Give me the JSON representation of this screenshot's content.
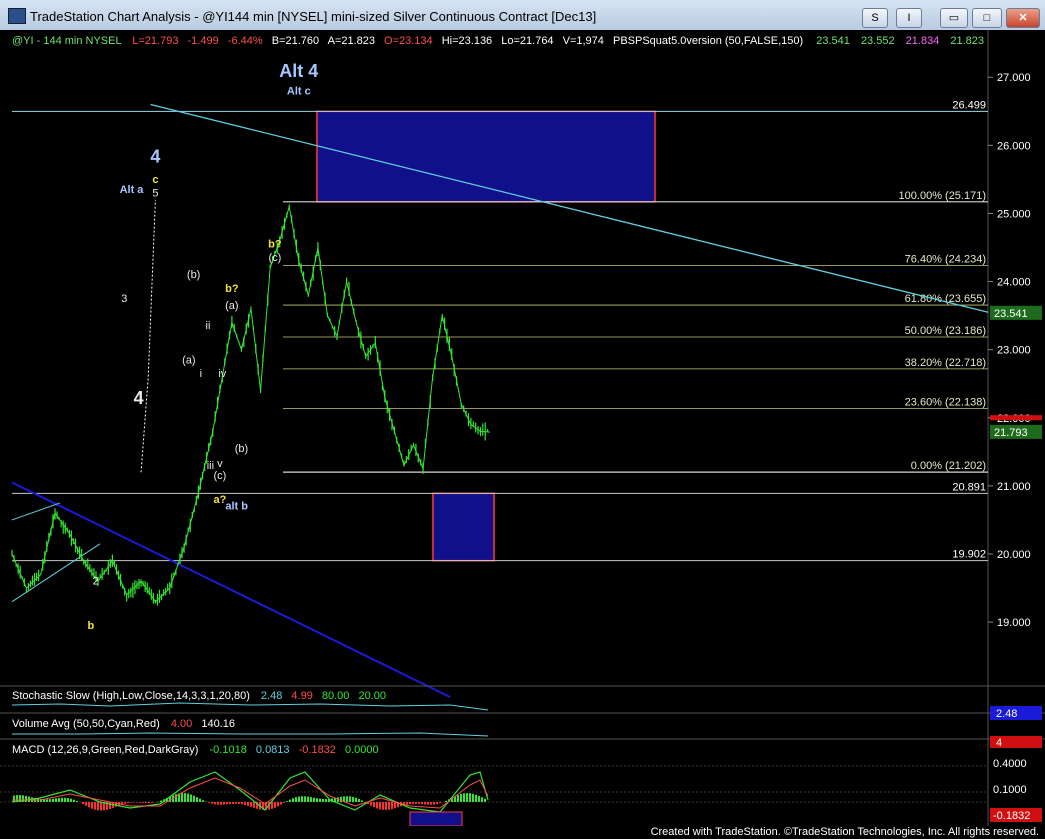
{
  "window": {
    "title": "TradeStation Chart Analysis - @YI144 min [NYSEL] mini-sized Silver Continuous Contract [Dec13]",
    "btn_s": "S",
    "btn_i": "I",
    "btn_min": "▭",
    "btn_max": "□",
    "btn_close": "✕"
  },
  "status": {
    "symbol": "@YI - 144 min  NYSEL",
    "last": "L=21.793",
    "change": "-1.499",
    "change_pct": "-6.44%",
    "bid": "B=21.760",
    "ask": "A=21.823",
    "open": "O=23.134",
    "high": "Hi=23.136",
    "low": "Lo=21.764",
    "volume": "V=1,974",
    "indicator": "PBSPSquat5.0version (50,FALSE,150)",
    "ind_v1": "23.541",
    "ind_v2": "23.552",
    "ind_v3": "21.834",
    "ind_v4": "21.823"
  },
  "colors": {
    "bars": "#33e633",
    "price_text": "#ffffff",
    "fib_line": "#c9c97a",
    "trend_cyan": "#5fd0e0",
    "trend_blue": "#1a1ad8",
    "box_fill": "#10108a",
    "box_border": "#ff3b3b",
    "label_blue": "#a8c6ff",
    "label_yellow": "#f0e040"
  },
  "chart_data": {
    "type": "line",
    "title": "@YI144 min [NYSEL] mini-sized Silver Continuous Contract [Dec13]",
    "ylim": [
      18.15,
      27.4
    ],
    "y_ticks": [
      "27.000",
      "26.000",
      "25.000",
      "24.000",
      "23.000",
      "22.000",
      "21.000",
      "20.000",
      "19.000"
    ],
    "y_tick_values": [
      27,
      26,
      25,
      24,
      23,
      22,
      21,
      20,
      19
    ],
    "x_range": [
      0,
      100
    ],
    "series": [
      {
        "name": "@YI",
        "x": [
          0,
          3,
          6,
          9,
          12,
          15,
          18,
          21,
          24,
          27,
          30,
          33,
          36,
          39,
          42,
          44,
          46,
          48,
          50,
          52,
          54,
          56,
          58,
          60,
          62,
          64,
          66,
          68,
          70,
          72,
          74,
          76,
          78,
          80,
          82,
          84,
          86,
          88,
          90,
          92,
          94,
          96,
          98,
          100
        ],
        "values": [
          20.0,
          19.5,
          19.7,
          20.6,
          20.3,
          19.9,
          19.6,
          19.9,
          19.4,
          19.6,
          19.3,
          19.5,
          20.1,
          20.9,
          21.8,
          22.6,
          23.4,
          23.0,
          23.6,
          22.4,
          24.2,
          24.6,
          25.1,
          24.3,
          23.8,
          24.5,
          23.5,
          23.2,
          24.0,
          23.4,
          22.9,
          23.1,
          22.3,
          21.8,
          21.3,
          21.6,
          21.25,
          22.6,
          23.5,
          22.9,
          22.2,
          21.9,
          21.8,
          21.79
        ]
      }
    ],
    "current_price": 21.793,
    "indicator_value": 23.541,
    "levels": [
      {
        "label": "100.00% (25.171)",
        "value": 25.171
      },
      {
        "label": "76.40% (24.234)",
        "value": 24.234
      },
      {
        "label": "61.80% (23.655)",
        "value": 23.655
      },
      {
        "label": "50.00% (23.186)",
        "value": 23.186
      },
      {
        "label": "38.20% (22.718)",
        "value": 22.718
      },
      {
        "label": "23.60% (22.138)",
        "value": 22.138
      },
      {
        "label": "0.00% (21.202)",
        "value": 21.202
      }
    ],
    "price_marks": [
      {
        "label": "26.499",
        "value": 26.499
      },
      {
        "label": "20.891",
        "value": 20.891
      },
      {
        "label": "19.902",
        "value": 19.902
      }
    ],
    "annotations": [
      {
        "text": "Alt 4",
        "color": "blue",
        "x": 60,
        "y": 27.0
      },
      {
        "text": "Alt c",
        "color": "blue",
        "x": 60,
        "y": 26.75
      },
      {
        "text": "4",
        "color": "blue",
        "x": 30,
        "y": 25.75
      },
      {
        "text": "c",
        "color": "yellow",
        "x": 30,
        "y": 25.45
      },
      {
        "text": "5",
        "color": "white",
        "x": 30,
        "y": 25.25
      },
      {
        "text": "Alt a",
        "color": "blue",
        "x": 25,
        "y": 25.3
      },
      {
        "text": "b?",
        "color": "yellow",
        "x": 55,
        "y": 24.5
      },
      {
        "text": "(c)",
        "color": "white",
        "x": 55,
        "y": 24.3
      },
      {
        "text": "b?",
        "color": "yellow",
        "x": 46,
        "y": 23.85
      },
      {
        "text": "(a)",
        "color": "white",
        "x": 46,
        "y": 23.6
      },
      {
        "text": "(b)",
        "color": "white",
        "x": 38,
        "y": 24.05
      },
      {
        "text": "3",
        "color": "white",
        "x": 23.5,
        "y": 23.7
      },
      {
        "text": "ii",
        "color": "white",
        "x": 41,
        "y": 23.3
      },
      {
        "text": "(a)",
        "color": "white",
        "x": 37,
        "y": 22.8
      },
      {
        "text": "i",
        "color": "white",
        "x": 39.5,
        "y": 22.6
      },
      {
        "text": "iv",
        "color": "white",
        "x": 44,
        "y": 22.6
      },
      {
        "text": "4",
        "color": "white",
        "x": 26.5,
        "y": 22.2
      },
      {
        "text": "(b)",
        "color": "white",
        "x": 48,
        "y": 21.5
      },
      {
        "text": "iii",
        "color": "white",
        "x": 41.5,
        "y": 21.25
      },
      {
        "text": "v",
        "color": "white",
        "x": 43.5,
        "y": 21.28
      },
      {
        "text": "(c)",
        "color": "white",
        "x": 43.5,
        "y": 21.1
      },
      {
        "text": "a?",
        "color": "yellow",
        "x": 43.5,
        "y": 20.75
      },
      {
        "text": "alt b",
        "color": "blue",
        "x": 47,
        "y": 20.65
      },
      {
        "text": "2",
        "color": "white",
        "x": 17.5,
        "y": 19.55
      },
      {
        "text": "b",
        "color": "yellow",
        "x": 16.5,
        "y": 18.9
      }
    ]
  },
  "indicators": {
    "stoch_label": "Stochastic Slow (High,Low,Close,14,3,3,1,20,80)",
    "stoch_v1": "2.48",
    "stoch_v2": "4.99",
    "stoch_v3": "80.00",
    "stoch_v4": "20.00",
    "stoch_axis": "2.48",
    "vol_label": "Volume Avg (50,50,Cyan,Red)",
    "vol_v1": "4.00",
    "vol_v2": "140.16",
    "vol_axis": "4",
    "macd_label": "MACD (12,26,9,Green,Red,DarkGray)",
    "macd_v1": "-0.1018",
    "macd_v2": "0.0813",
    "macd_v3": "-0.1832",
    "macd_v4": "0.0000",
    "macd_axis_1": "0.4000",
    "macd_axis_2": "0.1000",
    "macd_axis_3": "-0.1832"
  },
  "footer": {
    "credit": "Created with TradeStation. ©TradeStation Technologies, Inc. All rights reserved."
  }
}
